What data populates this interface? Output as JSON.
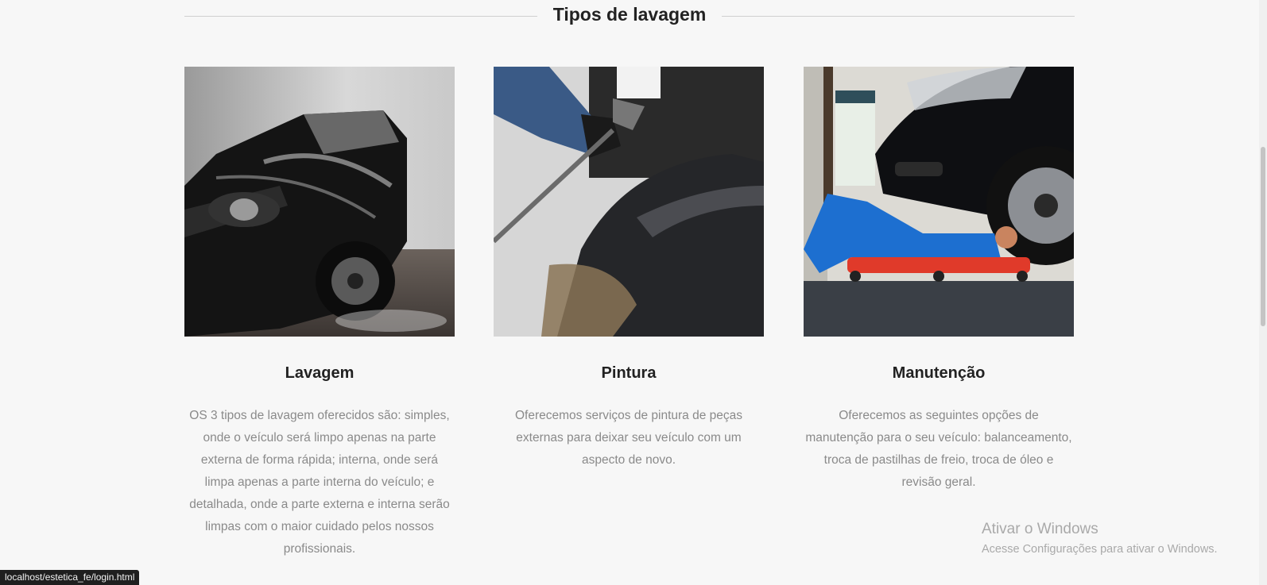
{
  "section": {
    "title": "Tipos de lavagem"
  },
  "cards": [
    {
      "title": "Lavagem",
      "description": "OS 3 tipos de lavagem oferecidos são: simples, onde o veículo será limpo apenas na parte externa de forma rápida; interna, onde será limpa apenas a parte interna do veículo; e detalhada, onde a parte externa e interna serão limpas com o maior cuidado pelos nossos profissionais.",
      "image": "car-wash-photo"
    },
    {
      "title": "Pintura",
      "description": "Oferecemos serviços de pintura de peças externas para deixar seu veículo com um aspecto de novo.",
      "image": "car-painting-photo"
    },
    {
      "title": "Manutenção",
      "description": "Oferecemos as seguintes opções de manutenção para o seu veículo: balanceamento, troca de pastilhas de freio, troca de óleo e revisão geral.",
      "image": "car-maintenance-photo"
    }
  ],
  "watermark": {
    "line1": "Ativar o Windows",
    "line2": "Acesse Configurações para ativar o Windows."
  },
  "status_bar": {
    "url": "localhost/estetica_fe/login.html"
  }
}
